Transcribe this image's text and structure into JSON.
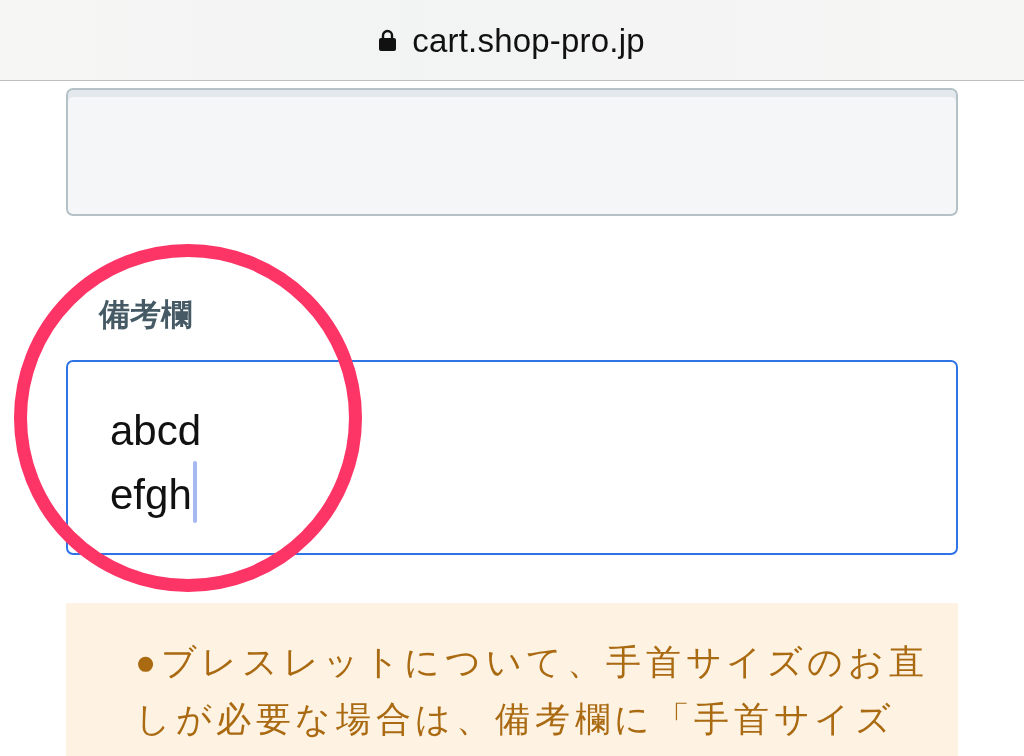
{
  "address_bar": {
    "secure": true,
    "url": "cart.shop-pro.jp"
  },
  "upper_field": {
    "disabled": true
  },
  "notes": {
    "label": "備考欄",
    "value": "abcd\nefgh",
    "focused": true
  },
  "annotation": {
    "kind": "circle"
  },
  "notice": {
    "lines": [
      "●ブレスレットについて、手首サイズのお直",
      "しが必要な場合は、備考欄に「手首サイズ"
    ]
  }
}
